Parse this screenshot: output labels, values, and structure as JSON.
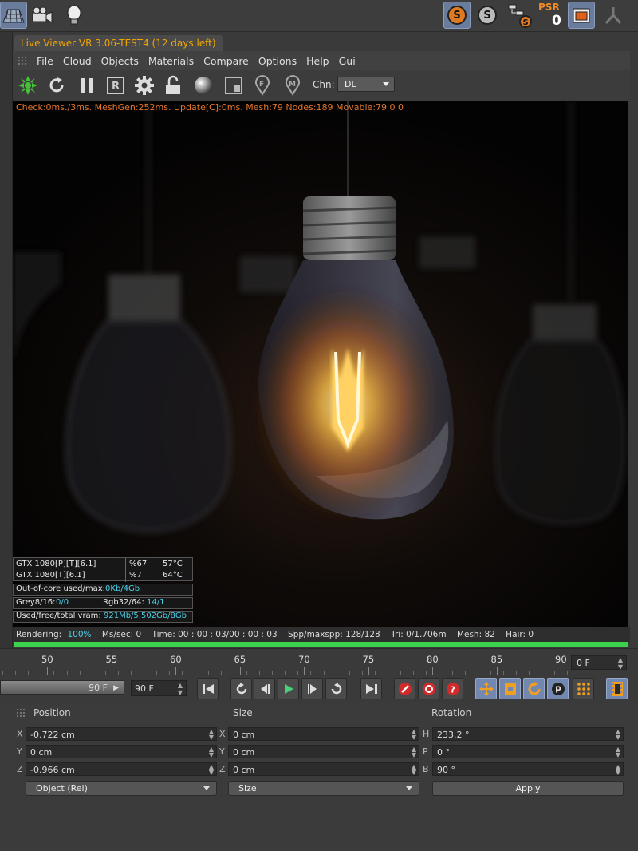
{
  "top_bar": {
    "psr_label": "PSR",
    "psr_value": "0",
    "s_label": "S"
  },
  "viewer": {
    "tab_title": "Live Viewer VR 3.06-TEST4 (12 days left)",
    "menu": [
      "File",
      "Cloud",
      "Objects",
      "Materials",
      "Compare",
      "Options",
      "Help",
      "Gui"
    ],
    "toolbar": {
      "icons": [
        "octane-logo-icon",
        "refresh-icon",
        "pause-icon",
        "r-region-icon",
        "gear-icon",
        "lock-icon",
        "material-sphere-icon",
        "focus-picker-icon",
        "f-pin-icon",
        "m-pin-icon"
      ],
      "r_letter": "R",
      "f_letter": "F",
      "m_letter": "M",
      "channel_label": "Chn:",
      "channel_value": "DL"
    },
    "stats_line": "Check:0ms./3ms. MeshGen:252ms. Update[C]:0ms. Mesh:79 Nodes:189 Movable:79  0 0",
    "gpus": [
      {
        "name": "GTX 1080[P][T][6.1]",
        "usage": "%67",
        "temp": "57°C"
      },
      {
        "name": "GTX 1080[T][6.1]",
        "usage": "%7",
        "temp": "64°C"
      }
    ],
    "out_of_core": {
      "label": "Out-of-core used/max:",
      "value": "0Kb/4Gb"
    },
    "grey": {
      "label": "Grey8/16:",
      "value": "0/0"
    },
    "rgb": {
      "label": "Rgb32/64:",
      "value": "14/1"
    },
    "vram": {
      "label": "Used/free/total vram:",
      "value": "921Mb/5.502Gb/8Gb"
    },
    "status": {
      "rendering_label": "Rendering:",
      "rendering_value": "100%",
      "mssec": "Ms/sec: 0",
      "time": "Time: 00 : 00 : 03/00 : 00 : 03",
      "spp": "Spp/maxspp: 128/128",
      "tri": "Tri: 0/1.706m",
      "mesh": "Mesh: 82",
      "hair": "Hair: 0"
    },
    "progress": 1.0
  },
  "timeline": {
    "labels": [
      "50",
      "55",
      "60",
      "65",
      "70",
      "75",
      "80",
      "85",
      "90"
    ],
    "frame_field": "0 F"
  },
  "transport": {
    "slider_value": "90 F",
    "frame_input": "90 F",
    "buttons": [
      "go-to-start-icon",
      "loop-back-icon",
      "step-back-icon",
      "play-icon",
      "step-forward-icon",
      "loop-forward-icon",
      "go-to-end-icon",
      "record-key-icon",
      "autokey-icon",
      "help-key-icon",
      "move-key-icon",
      "scale-key-icon",
      "rotate-key-icon",
      "p-key-icon",
      "dots-grid-icon",
      "film-strip-icon"
    ]
  },
  "attributes": {
    "headers": {
      "position": "Position",
      "size": "Size",
      "rotation": "Rotation"
    },
    "position": [
      {
        "axis": "X",
        "value": "-0.722 cm"
      },
      {
        "axis": "Y",
        "value": "0 cm"
      },
      {
        "axis": "Z",
        "value": "-0.966 cm"
      }
    ],
    "size": [
      {
        "axis": "X",
        "value": "0 cm"
      },
      {
        "axis": "Y",
        "value": "0 cm"
      },
      {
        "axis": "Z",
        "value": "0 cm"
      }
    ],
    "rotation": [
      {
        "axis": "H",
        "value": "233.2 °"
      },
      {
        "axis": "P",
        "value": "0 °"
      },
      {
        "axis": "B",
        "value": "90 °"
      }
    ],
    "mode_dropdown": "Object (Rel)",
    "size_dropdown": "Size",
    "apply_label": "Apply"
  }
}
